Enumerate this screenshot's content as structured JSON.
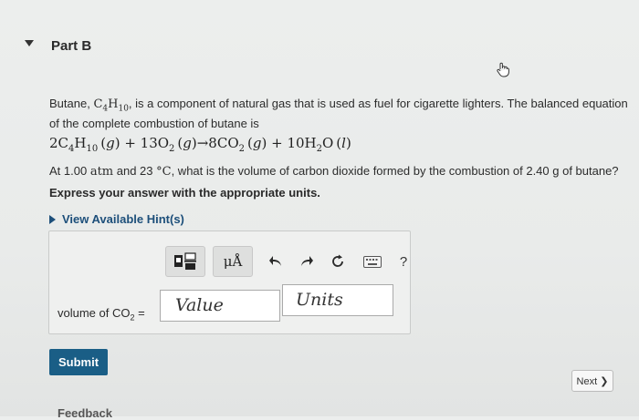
{
  "part": {
    "title": "Part B"
  },
  "problem": {
    "intro_pre": "Butane, ",
    "intro_post": ", is a component of natural gas that is used as fuel for cigarette lighters. The balanced equation of the complete combustion of butane is",
    "question_pre": "At 1.00 ",
    "question_unit_atm": "atm",
    "question_mid": " and 23 ",
    "question_unit_c": "°C",
    "question_post": ", what is the volume of carbon dioxide formed by the combustion of 2.40 g of butane?",
    "express": "Express your answer with the appropriate units."
  },
  "hint": {
    "label": "View Available Hint(s)"
  },
  "toolbar": {
    "units_symbol": "μÅ",
    "help": "?"
  },
  "answer": {
    "variable_pre": "volume of CO",
    "variable_sub": "2",
    "variable_post": " =",
    "value_placeholder": "Value",
    "units_placeholder": "Units"
  },
  "buttons": {
    "submit": "Submit",
    "next": "Next ❯"
  },
  "footer": {
    "feedback": "Feedback"
  },
  "colors": {
    "accent": "#1a5e86",
    "link": "#1d4f7a"
  },
  "icons": [
    "collapse-caret-icon",
    "hand-cursor-icon",
    "template-icon",
    "undo-icon",
    "redo-icon",
    "reset-icon",
    "keyboard-icon",
    "help-icon"
  ]
}
